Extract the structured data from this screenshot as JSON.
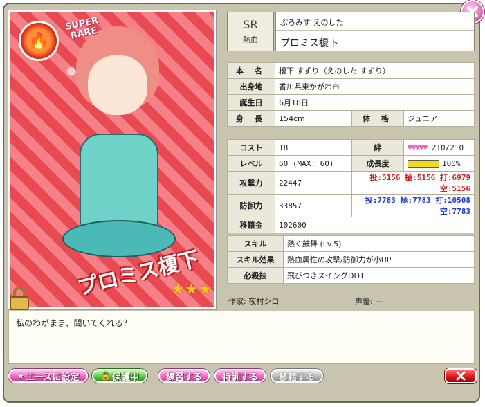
{
  "card": {
    "rarity_badge": "SUPER RARE",
    "name_plate": "プロミス榎下",
    "stars": "★★★★",
    "element_icon": "fire-icon",
    "lock_icon": "lock-icon"
  },
  "header": {
    "rarity": "SR",
    "attribute": "熱血",
    "name_reading": "ぷろみす えのした",
    "name_full": "プロミス榎下"
  },
  "profile": {
    "real_name_label": "本 名",
    "real_name": "榎下 すずり（えのした すずり）",
    "birthplace_label": "出身地",
    "birthplace": "香川県東かがわ市",
    "birthday_label": "誕生日",
    "birthday": "6月18日",
    "height_label": "身 長",
    "height": "154cm",
    "build_label": "体 格",
    "build": "ジュニア"
  },
  "stats": {
    "cost_label": "コスト",
    "cost": "18",
    "bond_label": "絆",
    "bond_hearts": "♥♥♥♥♥",
    "bond_value": "210/210",
    "level_label": "レベル",
    "level": "60 (MAX: 60)",
    "growth_label": "成長度",
    "growth_value": "100%",
    "growth_fraction": 1.0,
    "attack_label": "攻撃力",
    "attack": "22447",
    "attack_breakdown": "投:5156 極:5156 打:6979 空:5156",
    "defense_label": "防御力",
    "defense": "33857",
    "defense_breakdown": "投:7783 極:7783 打:10508 空:7783",
    "transfer_fee_label": "移籍金",
    "transfer_fee": "102600"
  },
  "skills": {
    "skill_label": "スキル",
    "skill": "熱く鼓舞 (Lv.5)",
    "effect_label": "スキル効果",
    "effect": "熱血属性の攻撃/防御力が小UP",
    "finisher_label": "必殺技",
    "finisher": "飛びつきスイングDDT"
  },
  "credits": {
    "artist": "作家: 夜村シロ",
    "voice": "声優: —"
  },
  "quote": "私のわがまま、聞いてくれる？",
  "buttons": {
    "set_ace": "エースに設定",
    "protected": "保護中",
    "practice": "練習する",
    "special_training": "特訓する",
    "transfer": "移籍する"
  },
  "colors": {
    "accent_pink": "#f15fbf",
    "protect_green": "#52c73d",
    "frame_bg": "#c9c4ae",
    "attack_red": "#d21d1d",
    "defense_blue": "#1d3ad2"
  }
}
